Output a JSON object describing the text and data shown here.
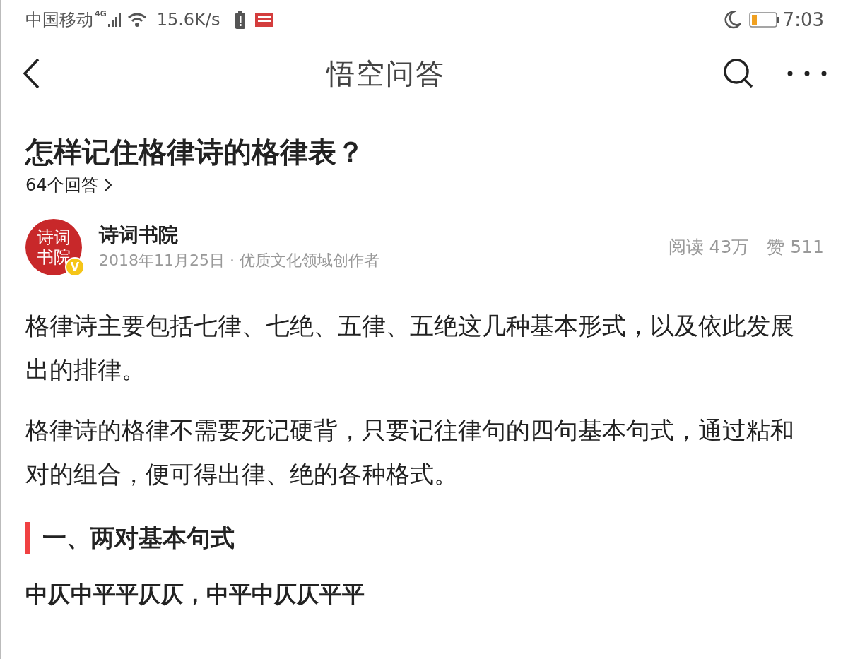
{
  "status_bar": {
    "carrier": "中国移动",
    "network": "4G",
    "speed": "15.6K/s",
    "time": "7:03"
  },
  "nav": {
    "title": "悟空问答"
  },
  "question": {
    "title": "怎样记住格律诗的格律表？",
    "answers": "64个回答"
  },
  "author": {
    "avatar_text": "诗词书院",
    "verified": true,
    "verified_mark": "V",
    "name": "诗词书院",
    "meta": "2018年11月25日 · 优质文化领域创作者",
    "reads": "阅读 43万",
    "likes": "赞 511"
  },
  "content": [
    {
      "kind": "paragraph",
      "text": "格律诗主要包括七律、七绝、五律、五绝这几种基本形式，以及依此发展出的排律。"
    },
    {
      "kind": "paragraph",
      "text": "格律诗的格律不需要死记硬背，只要记往律句的四句基本句式，通过粘和对的组合，便可得出律、绝的各种格式。"
    },
    {
      "kind": "heading",
      "text": "一、两对基本句式"
    },
    {
      "kind": "pattern",
      "text": "中仄中平平仄仄，中平中仄仄平平"
    }
  ]
}
